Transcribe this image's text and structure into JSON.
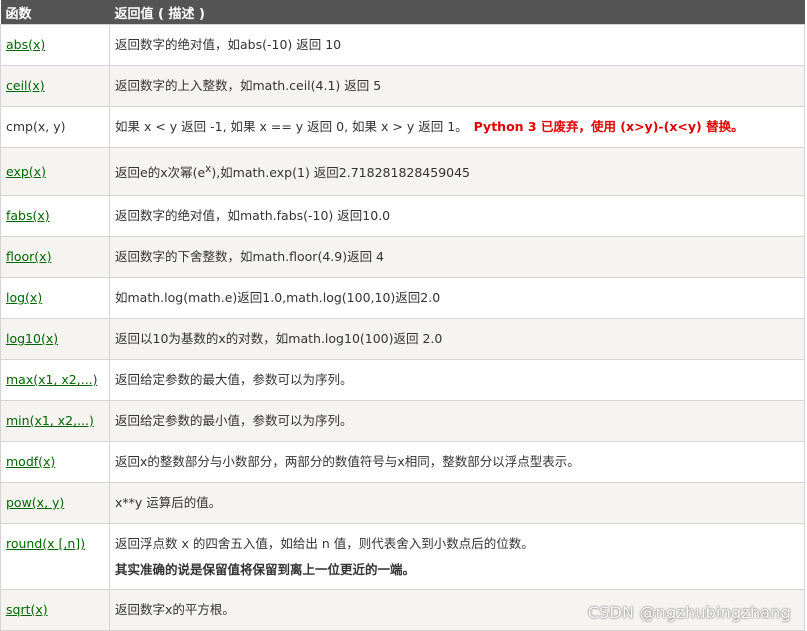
{
  "header": {
    "col_function": "函数",
    "col_description": "返回值 ( 描述 )"
  },
  "rows": [
    {
      "name": "abs(x)",
      "desc": "返回数字的绝对值，如abs(-10) 返回 10"
    },
    {
      "name": "ceil(x)",
      "desc": "返回数字的上入整数，如math.ceil(4.1) 返回 5"
    },
    {
      "name": "cmp(x, y)",
      "desc": "如果 x < y 返回 -1, 如果 x == y 返回 0, 如果 x > y 返回 1。",
      "warning": "Python 3 已废弃，使用 (x>y)-(x<y) 替换。"
    },
    {
      "name": "exp(x)",
      "desc_before": "返回e的x次幂(e",
      "sup": "x",
      "desc_after": "),如math.exp(1) 返回2.718281828459045"
    },
    {
      "name": "fabs(x)",
      "desc": "返回数字的绝对值，如math.fabs(-10) 返回10.0"
    },
    {
      "name": "floor(x)",
      "desc": "返回数字的下舍整数，如math.floor(4.9)返回 4"
    },
    {
      "name": "log(x)",
      "desc": "如math.log(math.e)返回1.0,math.log(100,10)返回2.0"
    },
    {
      "name": "log10(x)",
      "desc": "返回以10为基数的x的对数，如math.log10(100)返回 2.0"
    },
    {
      "name": "max(x1, x2,...)",
      "desc": "返回给定参数的最大值，参数可以为序列。"
    },
    {
      "name": "min(x1, x2,...)",
      "desc": "返回给定参数的最小值，参数可以为序列。"
    },
    {
      "name": "modf(x)",
      "desc": "返回x的整数部分与小数部分，两部分的数值符号与x相同，整数部分以浮点型表示。"
    },
    {
      "name": "pow(x, y)",
      "desc": "x**y 运算后的值。"
    },
    {
      "name": "round(x [,n])",
      "desc": "返回浮点数 x 的四舍五入值，如给出 n 值，则代表舍入到小数点后的位数。",
      "note": "其实准确的说是保留值将保留到离上一位更近的一端。"
    },
    {
      "name": "sqrt(x)",
      "desc": "返回数字x的平方根。"
    }
  ],
  "watermark": "CSDN @ngzhubingzhang"
}
